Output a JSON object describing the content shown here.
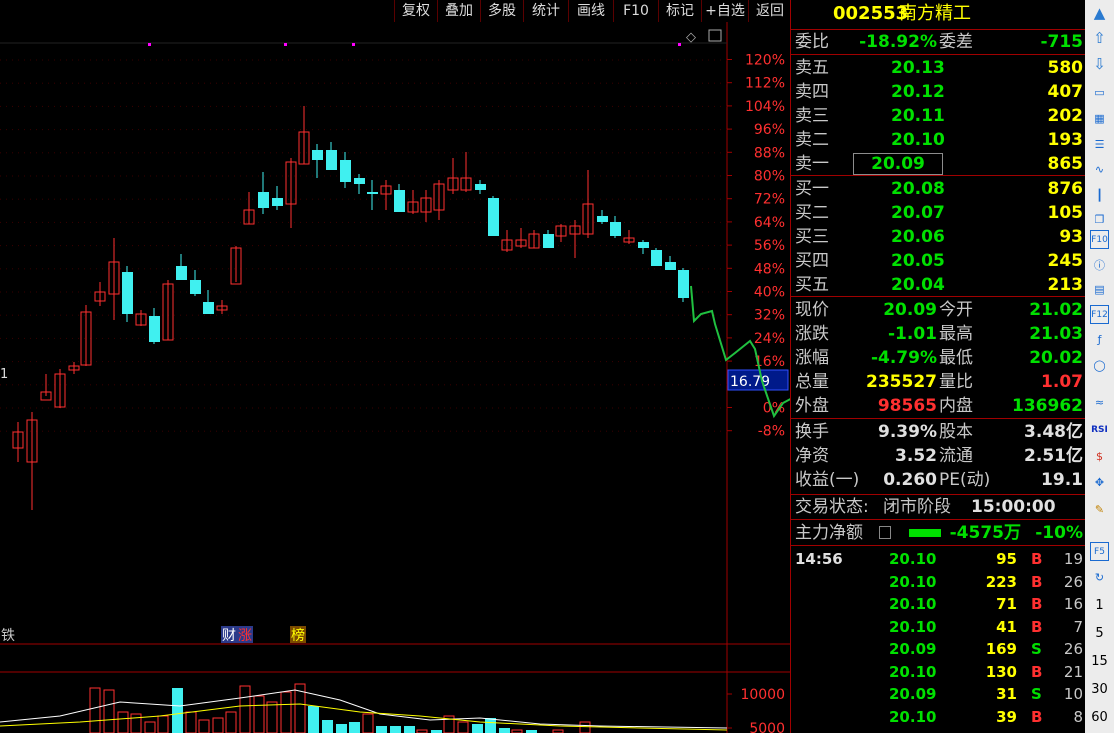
{
  "toolbar": {
    "buttons": [
      "复权",
      "叠加",
      "多股",
      "统计",
      "画线",
      "F10",
      "标记",
      "+自选",
      "返回"
    ]
  },
  "chart": {
    "pct_labels": [
      "120%",
      "112%",
      "104%",
      "96%",
      "88%",
      "80%",
      "72%",
      "64%",
      "56%",
      "48%",
      "40%",
      "32%",
      "24%",
      "16%",
      "8%",
      "0%",
      "-8%"
    ],
    "price_marker": "16.79",
    "left_edge_label": "1",
    "events": [
      {
        "label": "铁"
      },
      {
        "label": "财",
        "color": "#ffffff",
        "bg": "#2b3a8a"
      },
      {
        "label": "涨",
        "color": "#ff3030",
        "bg": "#2b3a8a"
      },
      {
        "label": "榜",
        "color": "#ffff00",
        "bg": "#7a4a00"
      }
    ],
    "volume_labels": [
      "10000",
      "5000"
    ],
    "colors": {
      "up": "#ff3030",
      "down": "#40f0f0",
      "grid": "#a00000",
      "axis_text": "#ff3030",
      "ma1": "#ffffff",
      "ma2": "#ffff00",
      "pen": "#20c040",
      "marker_bg": "#001a8a",
      "dot": "#ff00ff"
    }
  },
  "stock": {
    "code": "002553",
    "name": "南方精工"
  },
  "weibi": {
    "label1": "委比",
    "value1": "-18.92%",
    "label2": "委差",
    "value2": "-715"
  },
  "asks": [
    {
      "label": "卖五",
      "price": "20.13",
      "vol": "580"
    },
    {
      "label": "卖四",
      "price": "20.12",
      "vol": "407"
    },
    {
      "label": "卖三",
      "price": "20.11",
      "vol": "202"
    },
    {
      "label": "卖二",
      "price": "20.10",
      "vol": "193"
    },
    {
      "label": "卖一",
      "price": "20.09",
      "vol": "865"
    }
  ],
  "bids": [
    {
      "label": "买一",
      "price": "20.08",
      "vol": "876"
    },
    {
      "label": "买二",
      "price": "20.07",
      "vol": "105"
    },
    {
      "label": "买三",
      "price": "20.06",
      "vol": "93"
    },
    {
      "label": "买四",
      "price": "20.05",
      "vol": "245"
    },
    {
      "label": "买五",
      "price": "20.04",
      "vol": "213"
    }
  ],
  "quote": [
    {
      "l1": "现价",
      "v1": "20.09",
      "c1": "g",
      "l2": "今开",
      "v2": "21.02",
      "c2": "g"
    },
    {
      "l1": "涨跌",
      "v1": "-1.01",
      "c1": "g",
      "l2": "最高",
      "v2": "21.03",
      "c2": "g"
    },
    {
      "l1": "涨幅",
      "v1": "-4.79%",
      "c1": "g",
      "l2": "最低",
      "v2": "20.02",
      "c2": "g"
    },
    {
      "l1": "总量",
      "v1": "235527",
      "c1": "y",
      "l2": "量比",
      "v2": "1.07",
      "c2": "r"
    },
    {
      "l1": "外盘",
      "v1": "98565",
      "c1": "r",
      "l2": "内盘",
      "v2": "136962",
      "c2": "g"
    }
  ],
  "finance": [
    {
      "l1": "换手",
      "v1": "9.39%",
      "l2": "股本",
      "v2": "3.48亿"
    },
    {
      "l1": "净资",
      "v1": "3.52",
      "l2": "流通",
      "v2": "2.51亿"
    },
    {
      "l1": "收益(一)",
      "v1": "0.260",
      "l2": "PE(动)",
      "v2": "19.1"
    }
  ],
  "status": {
    "label": "交易状态:",
    "value": "闭市阶段",
    "time": "15:00:00"
  },
  "main_force": {
    "label": "主力净额",
    "value": "-4575万",
    "pct": "-10%"
  },
  "ticks": [
    {
      "time": "14:56",
      "price": "20.10",
      "vol": "95",
      "bs": "B",
      "n": "19"
    },
    {
      "time": "",
      "price": "20.10",
      "vol": "223",
      "bs": "B",
      "n": "26"
    },
    {
      "time": "",
      "price": "20.10",
      "vol": "71",
      "bs": "B",
      "n": "16"
    },
    {
      "time": "",
      "price": "20.10",
      "vol": "41",
      "bs": "B",
      "n": "7"
    },
    {
      "time": "",
      "price": "20.09",
      "vol": "169",
      "bs": "S",
      "n": "26"
    },
    {
      "time": "",
      "price": "20.10",
      "vol": "130",
      "bs": "B",
      "n": "21"
    },
    {
      "time": "",
      "price": "20.09",
      "vol": "31",
      "bs": "S",
      "n": "10"
    },
    {
      "time": "",
      "price": "20.10",
      "vol": "39",
      "bs": "B",
      "n": "8"
    }
  ],
  "side_icons": [
    "scroll-up-icon",
    "arrow-up-icon",
    "arrow-down-icon",
    "screen-icon",
    "table-icon",
    "list-icon",
    "line-chart-icon",
    "candlestick-icon",
    "window-icon",
    "f10-icon",
    "info-icon",
    "news-icon",
    "f12-icon",
    "fx-icon",
    "circle-icon",
    "trend-icon",
    "rsi-icon",
    "money-icon",
    "move-icon",
    "pen-icon",
    "f5-icon",
    "refresh-icon"
  ],
  "side_labels": {
    "rsi": "RSI",
    "f10": "F10",
    "f12": "F12",
    "f5": "F5"
  },
  "periods": [
    "1",
    "5",
    "15",
    "30",
    "60"
  ]
}
